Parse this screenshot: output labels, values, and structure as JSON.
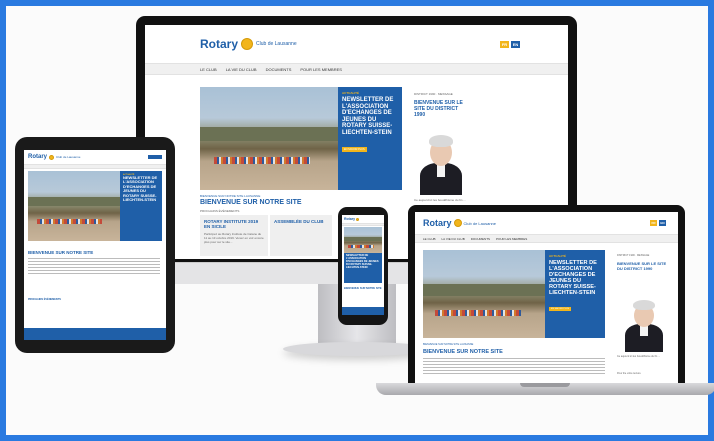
{
  "site": {
    "brand": "Rotary",
    "club": "Club de Lausanne",
    "lang_fr": "FR",
    "lang_en": "EN",
    "nav": [
      "LE CLUB",
      "LA VIE DU CLUB",
      "DOCUMENTS",
      "POUR LES MEMBRES"
    ],
    "hero_kicker": "ACTUALITÉ",
    "hero_title": "NEWSLETTER DE L'ASSOCIATION D'ECHANGES DE JEUNES DU ROTARY SUISSE-LIECHTEN-STEIN",
    "hero_more": "EN SAVOIR PLUS",
    "section_kicker": "BIENVENUE SUR NOTRE SITE LAUSANNE",
    "section_title": "BIENVENUE SUR NOTRE SITE",
    "events_title": "PROCHAINS ÉVÉNEMENTS",
    "event1_title": "ROTARY INSTITUTE 2019 EN SICILE",
    "event1_body": "Participez au Rotary Institute de Catane du 11 au 13 octobre 2019. Venez en voir encore plus pour sur le site...",
    "event2_title": "ASSEMBLÉE DU CLUB",
    "district_kicker": "DISTRICT 1990 · MESSAGE",
    "district_title": "BIENVENUE SUR LE SITE DU DISTRICT 1990",
    "district_body": "Ce aujourd ici les bouddhisme du fin ...",
    "read_more": "Pour lire votre lecture"
  },
  "colors": {
    "frame": "#2a7ae0",
    "rotary_blue": "#1f5fa8",
    "rotary_gold": "#f2b51b"
  }
}
